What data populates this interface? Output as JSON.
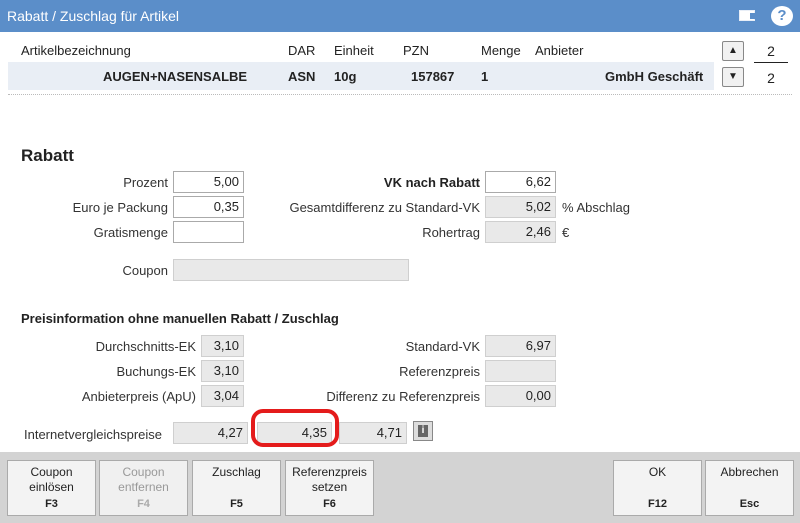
{
  "window": {
    "title": "Rabatt / Zuschlag für Artikel",
    "help_glyph": "?"
  },
  "table": {
    "headers": {
      "name": "Artikelbezeichnung",
      "dar": "DAR",
      "einheit": "Einheit",
      "pzn": "PZN",
      "menge": "Menge",
      "anbieter": "Anbieter"
    },
    "row": {
      "name": "AUGEN+NASENSALBE",
      "dar": "ASN",
      "einheit": "10g",
      "pzn": "157867",
      "menge": "1",
      "anbieter": "GmbH Geschäft"
    },
    "nav": {
      "up_glyph": "▲",
      "down_glyph": "▼",
      "top_count": "2",
      "bottom_count": "2"
    }
  },
  "rabatt": {
    "title": "Rabatt",
    "prozent_label": "Prozent",
    "prozent_value": "5,00",
    "euro_label": "Euro je Packung",
    "euro_value": "0,35",
    "gratis_label": "Gratismenge",
    "gratis_value": "",
    "coupon_label": "Coupon",
    "coupon_value": "",
    "vk_label": "VK nach Rabatt",
    "vk_value": "6,62",
    "gesamt_label": "Gesamtdifferenz zu Standard-VK",
    "gesamt_value": "5,02",
    "gesamt_unit": "% Abschlag",
    "roh_label": "Rohertrag",
    "roh_value": "2,46",
    "roh_unit": "€"
  },
  "preisinfo": {
    "title": "Preisinformation ohne manuellen Rabatt / Zuschlag",
    "dek_label": "Durchschnitts-EK",
    "dek_value": "3,10",
    "bek_label": "Buchungs-EK",
    "bek_value": "3,10",
    "apu_label": "Anbieterpreis (ApU)",
    "apu_value": "3,04",
    "svk_label": "Standard-VK",
    "svk_value": "6,97",
    "ref_label": "Referenzpreis",
    "ref_value": "",
    "diff_label": "Differenz zu Referenzpreis",
    "diff_value": "0,00",
    "ivp_label": "Internetvergleichspreise",
    "ivp_values": [
      "4,27",
      "4,35",
      "4,71"
    ]
  },
  "footer": {
    "coupon_einloesen": {
      "line1": "Coupon",
      "line2": "einlösen",
      "key": "F3"
    },
    "coupon_entfernen": {
      "line1": "Coupon",
      "line2": "entfernen",
      "key": "F4"
    },
    "zuschlag": {
      "line1": "Zuschlag",
      "key": "F5"
    },
    "referenzpreis": {
      "line1": "Referenzpreis",
      "line2": "setzen",
      "key": "F6"
    },
    "ok": {
      "line1": "OK",
      "key": "F12"
    },
    "abbrechen": {
      "line1": "Abbrechen",
      "key": "Esc"
    }
  },
  "colors": {
    "titlebar": "#5b8ec9",
    "highlight": "#e41b1b",
    "footer": "#d3d3d3"
  }
}
